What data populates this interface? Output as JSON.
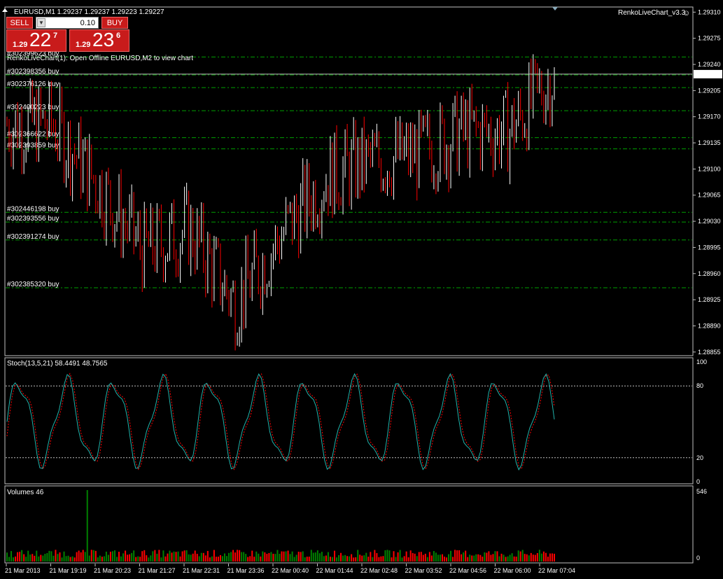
{
  "header": {
    "symbol_info": "EURUSD,M1  1.29237 1.29237 1.29223 1.29227",
    "indicator_name": "RenkoLiveChart_v3.3",
    "notice": "RenkoLiveChart(1): Open Offline EURUSD,M2 to view chart"
  },
  "trade": {
    "sell_label": "SELL",
    "buy_label": "BUY",
    "lot": "0.10",
    "sell_small": "1.29",
    "sell_big": "22",
    "sell_sup": "7",
    "buy_small": "1.29",
    "buy_big": "23",
    "buy_sup": "6",
    "bid_price": "1.29227"
  },
  "colors": {
    "background": "#000000",
    "bull_candle": "#ffffff",
    "bear_candle": "#ff0000",
    "order_line": "#00a000",
    "stoch_main": "#20b2aa",
    "stoch_signal": "#ff0000",
    "volume_up": "#008000",
    "volume_down": "#ff0000"
  },
  "orders": [
    {
      "label": "#302399623 buy",
      "price": 1.2925
    },
    {
      "label": "#302398356 buy",
      "price": 1.29226
    },
    {
      "label": "#302376126 buy",
      "price": 1.29209
    },
    {
      "label": "#302400223 buy",
      "price": 1.29178
    },
    {
      "label": "#302366622 buy",
      "price": 1.29142
    },
    {
      "label": "#302393859 buy",
      "price": 1.29127
    },
    {
      "label": "#302446198 buy",
      "price": 1.29042
    },
    {
      "label": "#302393556 buy",
      "price": 1.29029
    },
    {
      "label": "#302391274 buy",
      "price": 1.29005
    },
    {
      "label": "#302385320 buy",
      "price": 1.28941
    }
  ],
  "price_axis": {
    "min": 1.28852,
    "max": 1.29315,
    "ticks": [
      "1.29310",
      "1.29275",
      "1.29240",
      "1.29205",
      "1.29170",
      "1.29135",
      "1.29100",
      "1.29065",
      "1.29030",
      "1.28995",
      "1.28960",
      "1.28925",
      "1.28890",
      "1.28855"
    ]
  },
  "time_axis": {
    "labels": [
      "21 Mar 2013",
      "21 Mar 19:19",
      "21 Mar 20:23",
      "21 Mar 21:27",
      "21 Mar 22:31",
      "21 Mar 23:36",
      "22 Mar 00:40",
      "22 Mar 01:44",
      "22 Mar 02:48",
      "22 Mar 03:52",
      "22 Mar 04:56",
      "22 Mar 06:00",
      "22 Mar 07:04"
    ]
  },
  "stoch": {
    "title": "Stoch(13,5,21) 58.4491 48.7565",
    "axis": [
      "100",
      "80",
      "20",
      "0"
    ],
    "levels": [
      80,
      20
    ]
  },
  "volumes": {
    "title": "Volumes 46",
    "axis_max": "546",
    "axis_min": "0"
  },
  "chart_data": {
    "type": "line",
    "title": "EURUSD,M1",
    "xlabel": "",
    "ylabel": "",
    "ylim": [
      1.28852,
      1.29315
    ],
    "x": [
      "21 Mar 2013",
      "21 Mar 19:19",
      "21 Mar 20:23",
      "21 Mar 21:27",
      "21 Mar 22:31",
      "21 Mar 23:36",
      "22 Mar 00:40",
      "22 Mar 01:44",
      "22 Mar 02:48",
      "22 Mar 03:52",
      "22 Mar 04:56",
      "22 Mar 06:00",
      "22 Mar 07:04"
    ],
    "series": [
      {
        "values": [
          1.2916,
          1.2916,
          1.2908,
          1.2899,
          1.2902,
          1.2892,
          1.2901,
          1.2909,
          1.2911,
          1.2912,
          1.2915,
          1.2915,
          1.29227
        ]
      }
    ]
  }
}
